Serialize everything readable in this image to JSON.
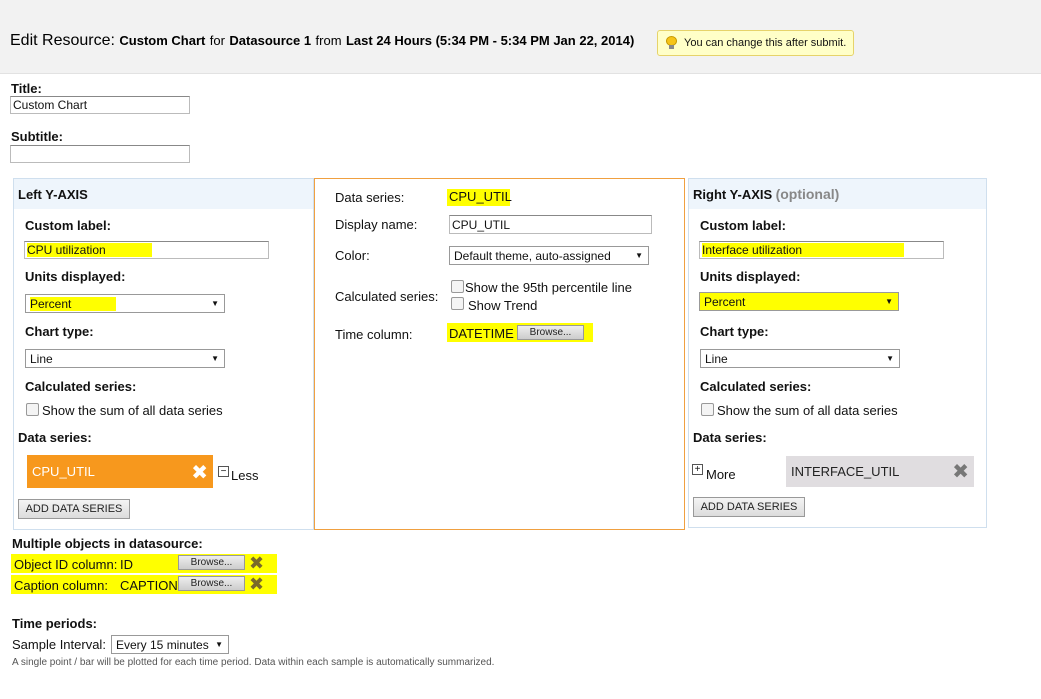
{
  "header": {
    "title_prefix": "Edit Resource:",
    "resource": "Custom Chart",
    "for_text": "for",
    "datasource": "Datasource 1",
    "from_text": "from",
    "time_range": "Last 24 Hours (5:34 PM - 5:34 PM Jan 22, 2014)",
    "hint": "You can change this after submit."
  },
  "form": {
    "title_label": "Title:",
    "title_value": "Custom Chart",
    "subtitle_label": "Subtitle:",
    "subtitle_value": ""
  },
  "left_axis": {
    "heading": "Left Y-AXIS",
    "custom_label_label": "Custom label:",
    "custom_label_value": "CPU utilization",
    "units_label": "Units displayed:",
    "units_value": "Percent",
    "chart_type_label": "Chart type:",
    "chart_type_value": "Line",
    "calc_label": "Calculated series:",
    "sum_label": "Show the sum of all data series",
    "data_series_label": "Data series:",
    "series_item": "CPU_UTIL",
    "less_label": "Less",
    "add_button": "ADD DATA SERIES"
  },
  "series_detail": {
    "data_series_label": "Data series:",
    "data_series_value": "CPU_UTIL",
    "display_name_label": "Display name:",
    "display_name_value": "CPU_UTIL",
    "color_label": "Color:",
    "color_value": "Default theme, auto-assigned",
    "calc_label": "Calculated series:",
    "p95_label": "Show the 95th percentile line",
    "trend_label": "Show Trend",
    "time_column_label": "Time column:",
    "time_column_value": "DATETIME",
    "browse_label": "Browse..."
  },
  "right_axis": {
    "heading": "Right Y-AXIS",
    "optional": "(optional)",
    "custom_label_label": "Custom label:",
    "custom_label_value": "Interface utilization",
    "units_label": "Units displayed:",
    "units_value": "Percent",
    "chart_type_label": "Chart type:",
    "chart_type_value": "Line",
    "calc_label": "Calculated series:",
    "sum_label": "Show the sum of all data series",
    "data_series_label": "Data series:",
    "more_label": "More",
    "series_item": "INTERFACE_UTIL",
    "add_button": "ADD DATA SERIES"
  },
  "multi_objects": {
    "heading": "Multiple objects in datasource:",
    "object_id_label": "Object ID column:",
    "object_id_value": "ID",
    "caption_label": "Caption column:",
    "caption_value": "CAPTION",
    "browse_label": "Browse..."
  },
  "time_periods": {
    "heading": "Time periods:",
    "interval_label": "Sample Interval:",
    "interval_value": "Every 15 minutes",
    "note": "A single point / bar will be plotted for each time period. Data within each sample is automatically summarized."
  },
  "colors": {
    "highlight": "#ffff00",
    "series_active": "#f7981d",
    "panel_border": "#cfdfee",
    "detail_border": "#f0a040"
  }
}
